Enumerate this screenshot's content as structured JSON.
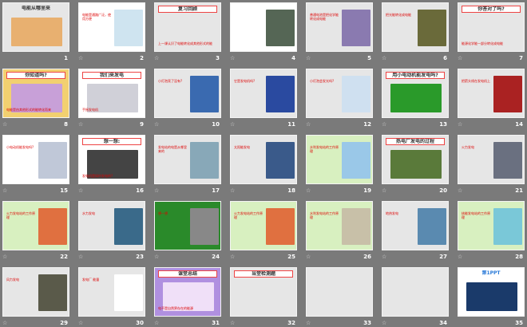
{
  "colors": {
    "background": "#7a7a7a",
    "slide": "#e6e6e6"
  },
  "transition_icon": "☆",
  "slides": [
    {
      "number": "1",
      "title": "电能从哪里来",
      "bg": "#e6e6e6",
      "pic": "#e8b070",
      "transition": false
    },
    {
      "number": "2",
      "title": "",
      "text": "电能是通路广泛，使用方便",
      "bg": "#ffffff",
      "pic": "#cfe4f0",
      "transition": true
    },
    {
      "number": "3",
      "title": "复习回顾",
      "text": "上一课认识了电能转化成其他形式的能",
      "bg": "#e6e6e6",
      "pic": "#e6e6e6",
      "transition": true
    },
    {
      "number": "4",
      "title": "",
      "bg": "#ffffff",
      "pic": "#556655",
      "transition": true
    },
    {
      "number": "5",
      "title": "",
      "text": "普通电池是把化学能转化成电能",
      "bg": "#e6e6e6",
      "pic": "#8a7ab0",
      "transition": true
    },
    {
      "number": "6",
      "title": "",
      "text": "把光能转化成电能",
      "bg": "#e6e6e6",
      "pic": "#6a6a3a",
      "transition": true
    },
    {
      "number": "7",
      "title": "你答对了吗?",
      "text": "能源化学能一部分转化成电能",
      "bg": "#e6e6e6",
      "pic": "#e6e6e6",
      "transition": true
    },
    {
      "number": "8",
      "title": "你知道吗?",
      "text": "电能是由其他形式的能转化而来",
      "bg": "#f2d070",
      "pic": "#c8a0d8",
      "transition": true
    },
    {
      "number": "9",
      "title": "我们来发电",
      "text": "手摇发电机",
      "bg": "#ffffff",
      "pic": "#d0d0d8",
      "transition": true
    },
    {
      "number": "10",
      "title": "",
      "text": "小灯泡亮了没有?",
      "bg": "#e6e6e6",
      "pic": "#3a6ab0",
      "transition": true
    },
    {
      "number": "11",
      "title": "",
      "text": "它是发电机吗?",
      "bg": "#e6e6e6",
      "pic": "#2a4aa0",
      "transition": true
    },
    {
      "number": "12",
      "title": "",
      "text": "小灯泡会发光吗?",
      "bg": "#e6e6e6",
      "pic": "#cfe0f0",
      "transition": true
    },
    {
      "number": "13",
      "title": "用小电动机能发电吗?",
      "text": "",
      "bg": "#e6e6e6",
      "pic": "#2a9a2a",
      "transition": true
    },
    {
      "number": "14",
      "title": "",
      "text": "把箭头线在发电机上",
      "bg": "#e6e6e6",
      "pic": "#aa2222",
      "transition": true
    },
    {
      "number": "15",
      "title": "",
      "text": "小电动机能发电吗?",
      "bg": "#ffffff",
      "pic": "#c0c8d8",
      "transition": true
    },
    {
      "number": "16",
      "title": "想一想:",
      "text": "发电机是如何发电的?",
      "bg": "#ffffff",
      "pic": "#444444",
      "transition": true
    },
    {
      "number": "17",
      "title": "",
      "text": "发电站的电是从哪里来的",
      "bg": "#e6e6e6",
      "pic": "#88a8b8",
      "transition": true
    },
    {
      "number": "18",
      "title": "",
      "text": "太阳能发电",
      "bg": "#e6e6e6",
      "pic": "#3a5a8a",
      "transition": true
    },
    {
      "number": "19",
      "title": "",
      "text": "水利发电站的工作原理",
      "bg": "#d8f0c0",
      "pic": "#9ac8e8",
      "transition": true
    },
    {
      "number": "20",
      "title": "热电厂发电的过程",
      "text": "",
      "bg": "#e6e6e6",
      "pic": "#5a7a3a",
      "transition": true
    },
    {
      "number": "21",
      "title": "",
      "text": "火力发电",
      "bg": "#e6e6e6",
      "pic": "#6a7080",
      "transition": true
    },
    {
      "number": "22",
      "title": "",
      "text": "火力发电站的工作原理",
      "bg": "#d8f0c0",
      "pic": "#e07040",
      "transition": true
    },
    {
      "number": "23",
      "title": "",
      "text": "水力发电",
      "bg": "#e6e6e6",
      "pic": "#3a6a8a",
      "transition": true
    },
    {
      "number": "24",
      "title": "",
      "text": "想一想",
      "bg": "#2a8a2a",
      "pic": "#888888",
      "transition": true
    },
    {
      "number": "25",
      "title": "",
      "text": "火力发电站的工作原理",
      "bg": "#d8f0c0",
      "pic": "#e07040",
      "transition": true
    },
    {
      "number": "26",
      "title": "",
      "text": "水利发电站的工作原理",
      "bg": "#d8f0c0",
      "pic": "#c8c0a8",
      "transition": true
    },
    {
      "number": "27",
      "title": "",
      "text": "地热发电",
      "bg": "#e6e6e6",
      "pic": "#5a8ab0",
      "transition": true
    },
    {
      "number": "28",
      "title": "",
      "text": "核能发电站的工作原理",
      "bg": "#d8f0c0",
      "pic": "#7ac8d8",
      "transition": true
    },
    {
      "number": "29",
      "title": "",
      "text": "风力发电",
      "bg": "#e6e6e6",
      "pic": "#5a5a4a",
      "transition": true
    },
    {
      "number": "30",
      "title": "",
      "text": "发电厂 能量",
      "bg": "#e6e6e6",
      "pic": "#ffffff",
      "transition": true
    },
    {
      "number": "31",
      "title": "课堂总结",
      "text": "电不是自然界存在的能源",
      "bg": "#b090e0",
      "pic": "#f0e0f8",
      "transition": true
    },
    {
      "number": "32",
      "title": "当堂检测题",
      "text": "",
      "bg": "#e6e6e6",
      "pic": "#e6e6e6",
      "transition": true
    },
    {
      "number": "33",
      "title": "",
      "text": "",
      "bg": "#e6e6e6",
      "pic": "#e6e6e6",
      "transition": true
    },
    {
      "number": "34",
      "title": "",
      "text": "",
      "bg": "#e6e6e6",
      "pic": "#e6e6e6",
      "transition": true
    },
    {
      "number": "35",
      "title": "第1PPT",
      "text": "",
      "bg": "#ffffff",
      "pic": "#1a3a6a",
      "transition": false
    }
  ]
}
